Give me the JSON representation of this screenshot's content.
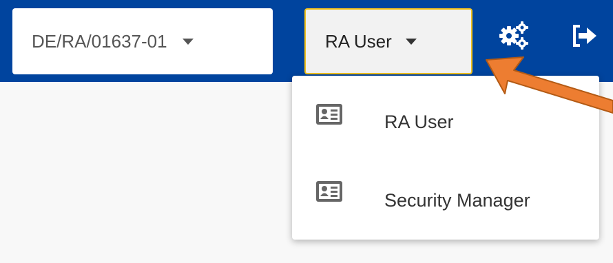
{
  "header": {
    "organization_select": {
      "value": "DE/RA/01637-01"
    },
    "role_select": {
      "value": "RA User"
    },
    "settings_icon": "gears-icon",
    "logout_icon": "sign-out-icon"
  },
  "role_menu": {
    "items": [
      {
        "label": "RA User",
        "icon": "id-card-icon"
      },
      {
        "label": "Security Manager",
        "icon": "id-card-icon"
      }
    ]
  },
  "annotation": {
    "arrow_color": "#ed7d31"
  },
  "colors": {
    "header_bg": "#00449e",
    "highlight_border": "#f2c21b",
    "page_bg": "#f8f8f8"
  }
}
